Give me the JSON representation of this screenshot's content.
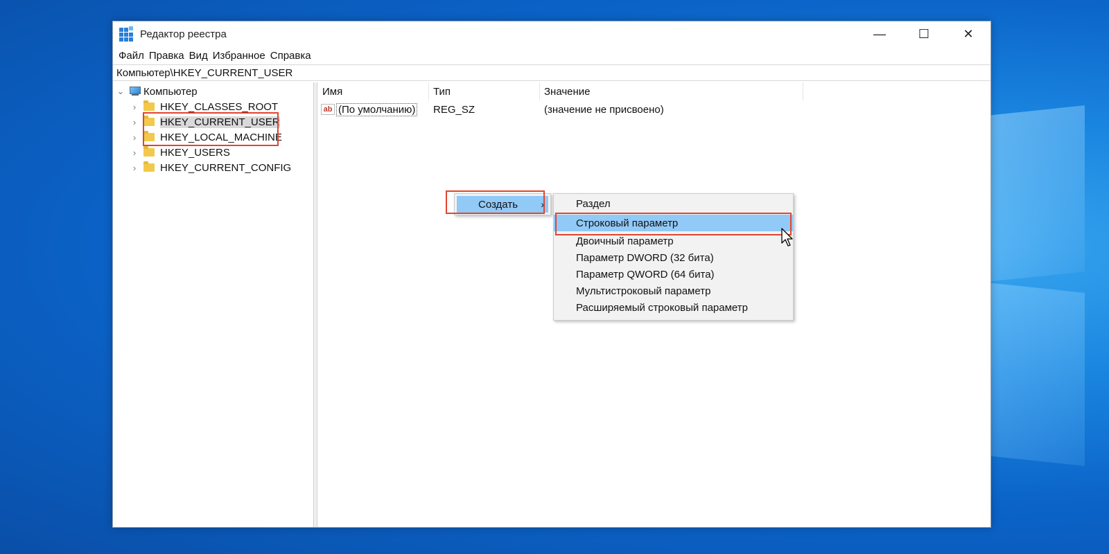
{
  "window": {
    "title": "Редактор реестра",
    "controls": {
      "minimize": "—",
      "maximize": "☐",
      "close": "✕"
    }
  },
  "menu": [
    "Файл",
    "Правка",
    "Вид",
    "Избранное",
    "Справка"
  ],
  "address": "Компьютер\\HKEY_CURRENT_USER",
  "tree": {
    "root": "Компьютер",
    "items": [
      {
        "label": "HKEY_CLASSES_ROOT",
        "selected": false
      },
      {
        "label": "HKEY_CURRENT_USER",
        "selected": true
      },
      {
        "label": "HKEY_LOCAL_MACHINE",
        "selected": false
      },
      {
        "label": "HKEY_USERS",
        "selected": false
      },
      {
        "label": "HKEY_CURRENT_CONFIG",
        "selected": false
      }
    ]
  },
  "list": {
    "columns": [
      "Имя",
      "Тип",
      "Значение"
    ],
    "rows": [
      {
        "name": "(По умолчанию)",
        "type": "REG_SZ",
        "value": "(значение не присвоено)",
        "icon": "ab-string-icon"
      }
    ]
  },
  "context_menu": {
    "create_label": "Создать",
    "submenu_arrow": "›",
    "submenu": [
      "Раздел",
      "Строковый параметр",
      "Двоичный параметр",
      "Параметр DWORD (32 бита)",
      "Параметр QWORD (64 бита)",
      "Мультистроковый параметр",
      "Расширяемый строковый параметр"
    ]
  },
  "colors": {
    "highlight_outline": "#e0452f",
    "menu_active": "#91c9f7",
    "desktop": "#1a86e0"
  }
}
